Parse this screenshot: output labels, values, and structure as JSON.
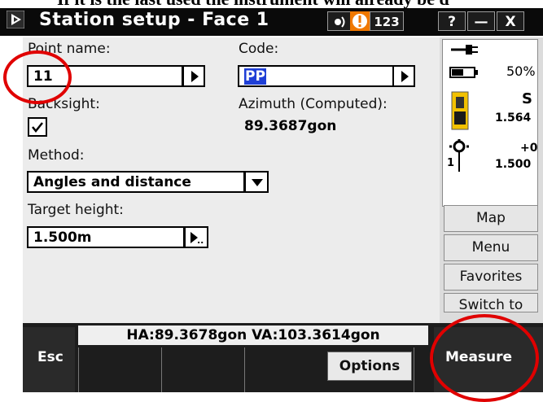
{
  "doc_caption": "If it is the last used the instrument will already be d",
  "window": {
    "title": "Station setup - Face 1",
    "title_icons": [
      "network-icon",
      "warning-icon",
      "123"
    ],
    "help_label": "?",
    "minimize_label": "—",
    "close_label": "X"
  },
  "form": {
    "point_name_label": "Point name:",
    "point_name_value": "11",
    "code_label": "Code:",
    "code_value": "PP",
    "backsight_label": "Backsight:",
    "backsight_checked": true,
    "azimuth_label": "Azimuth (Computed):",
    "azimuth_value": "89.3687gon",
    "method_label": "Method:",
    "method_value": "Angles and distance",
    "target_height_label": "Target height:",
    "target_height_value": "1.500m"
  },
  "status_panel": {
    "battery_percent": "50%",
    "instrument_letter": "S",
    "instrument_height": "1.564",
    "target_offset": "+0",
    "target_number": "1",
    "target_height": "1.500"
  },
  "side_buttons": {
    "map": "Map",
    "menu": "Menu",
    "favorites": "Favorites",
    "switch_to": "Switch to"
  },
  "bottom": {
    "angles_status": "HA:89.3678gon  VA:103.3614gon",
    "esc_label": "Esc",
    "options_label": "Options",
    "measure_label": "Measure"
  },
  "colors": {
    "highlight_blue": "#1f3fd6",
    "annotation_red": "#e00000",
    "warning_orange": "#f07800"
  }
}
